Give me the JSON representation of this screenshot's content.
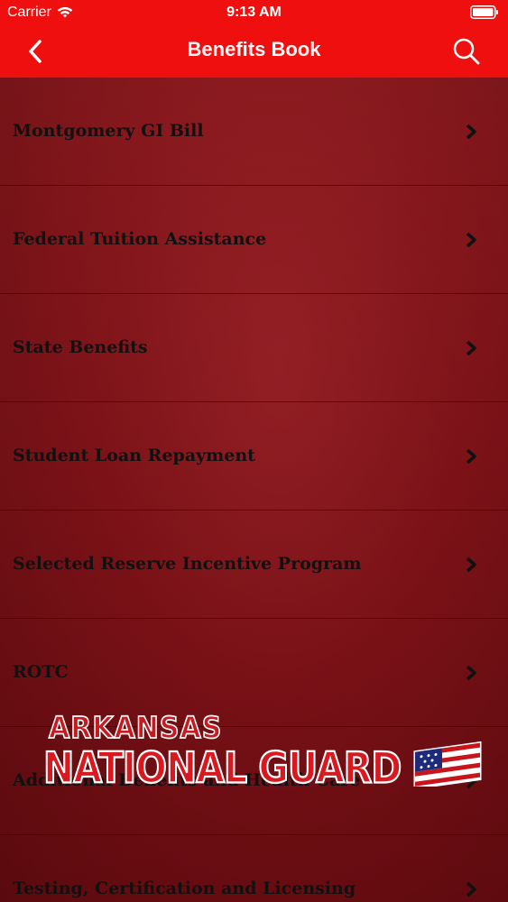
{
  "status_bar": {
    "carrier": "Carrier",
    "time": "9:13 AM"
  },
  "nav": {
    "title": "Benefits Book",
    "back_icon": "chevron-left-icon",
    "search_icon": "search-icon"
  },
  "list": {
    "items": [
      {
        "label": "Montgomery GI Bill"
      },
      {
        "label": "Federal Tuition Assistance"
      },
      {
        "label": "State Benefits"
      },
      {
        "label": "Student Loan Repayment"
      },
      {
        "label": "Selected Reserve Incentive Program"
      },
      {
        "label": "ROTC"
      },
      {
        "label": "Additional Benefits and Health Care"
      },
      {
        "label": "Testing, Certification and Licensing"
      }
    ]
  },
  "logo": {
    "line1": "ARKANSAS",
    "line2": "NATIONAL GUARD"
  },
  "colors": {
    "header": "#f00f0f",
    "background": "#7d1218",
    "text": "#111111"
  }
}
